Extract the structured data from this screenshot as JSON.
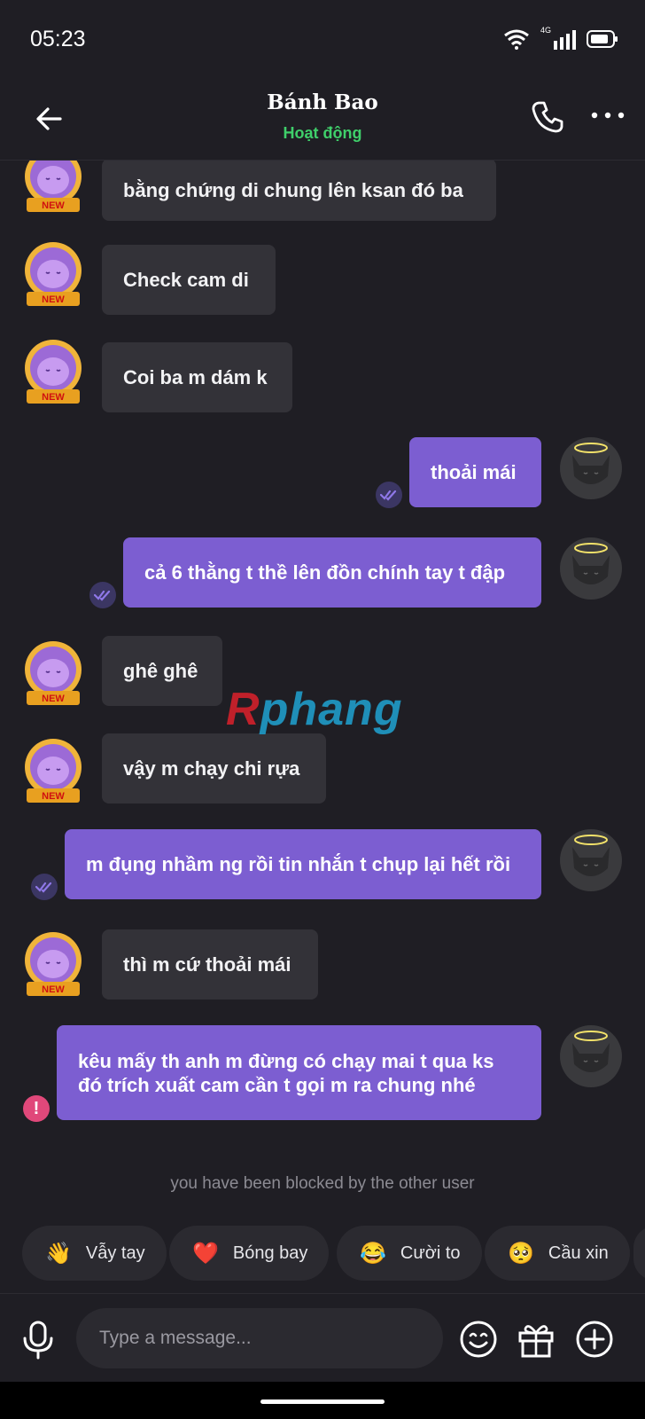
{
  "status_bar": {
    "time": "05:23",
    "network": "4G"
  },
  "header": {
    "title": "Bánh Bao",
    "subtitle": "Hoạt động"
  },
  "messages": [
    {
      "side": "in",
      "text": "bằng chứng di chung lên ksan đó ba"
    },
    {
      "side": "in",
      "text": "Check cam di"
    },
    {
      "side": "in",
      "text": "Coi ba m dám k"
    },
    {
      "side": "out",
      "text": "thoải mái",
      "status": "read"
    },
    {
      "side": "out",
      "text": "cả 6 thằng t thề lên đồn chính tay t đập",
      "status": "read"
    },
    {
      "side": "in",
      "text": "ghê ghê"
    },
    {
      "side": "in",
      "text": "vậy m chạy chi rựa"
    },
    {
      "side": "out",
      "text": "m đụng nhầm ng rồi tin nhắn t chụp lại hết rồi",
      "status": "read"
    },
    {
      "side": "in",
      "text": "thì m cứ thoải mái"
    },
    {
      "side": "out",
      "text": "kêu mấy th anh m đừng có chạy mai t qua ks đó trích xuất cam cần t gọi m ra chung nhé",
      "status": "failed"
    }
  ],
  "watermark": {
    "part1": "R",
    "part2": "phang"
  },
  "badge_text": "NEW",
  "blocked_notice": "you have been blocked by the other user",
  "quick_replies": [
    {
      "emoji": "👋",
      "label": "Vẫy tay"
    },
    {
      "emoji": "❤️",
      "label": "Bóng bay"
    },
    {
      "emoji": "😂",
      "label": "Cười to"
    },
    {
      "emoji": "🥺",
      "label": "Cầu xin"
    }
  ],
  "composer": {
    "placeholder": "Type a message..."
  },
  "colors": {
    "background": "#1f1e24",
    "incoming_bubble": "#333238",
    "outgoing_bubble": "#7c5ed1",
    "online": "#3fcf6a",
    "error": "#e0487a"
  }
}
